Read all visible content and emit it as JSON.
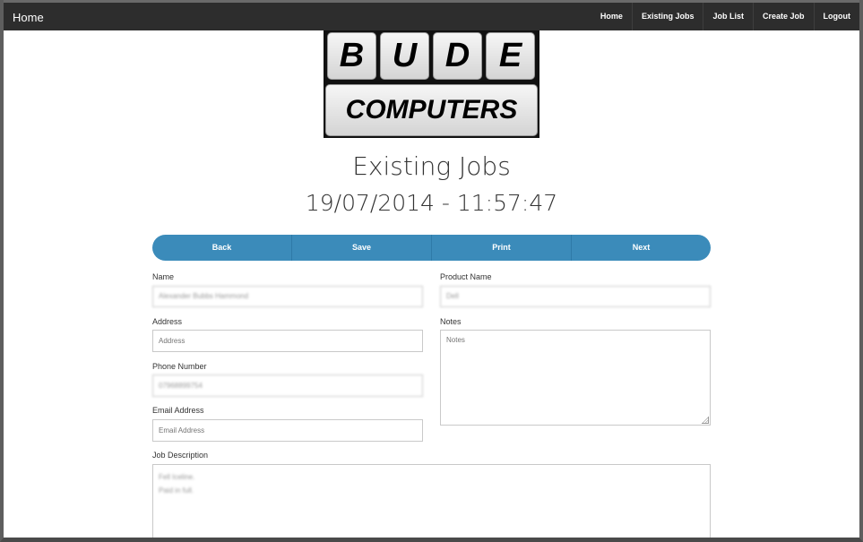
{
  "navbar": {
    "brand": "Home",
    "links": [
      "Home",
      "Existing Jobs",
      "Job List",
      "Create Job",
      "Logout"
    ],
    "background": "#2d2d2d"
  },
  "logo": {
    "letters": [
      "B",
      "U",
      "D",
      "E"
    ],
    "word": "COMPUTERS"
  },
  "page": {
    "title": "Existing Jobs",
    "timestamp": "19/07/2014 - 11:57:47"
  },
  "actions": {
    "back": "Back",
    "save": "Save",
    "print": "Print",
    "next": "Next",
    "accent": "#3b8bba"
  },
  "form": {
    "name": {
      "label": "Name",
      "value": "Alexander Bubbs Hammond"
    },
    "address": {
      "label": "Address",
      "placeholder": "Address"
    },
    "phone": {
      "label": "Phone Number",
      "value": "07968899754"
    },
    "email": {
      "label": "Email Address",
      "placeholder": "Email Address"
    },
    "product": {
      "label": "Product Name",
      "value": "Dell"
    },
    "notes": {
      "label": "Notes",
      "placeholder": "Notes"
    },
    "description": {
      "label": "Job Description",
      "lines": [
        "Fell Iceline.",
        "Paid in full."
      ]
    }
  }
}
